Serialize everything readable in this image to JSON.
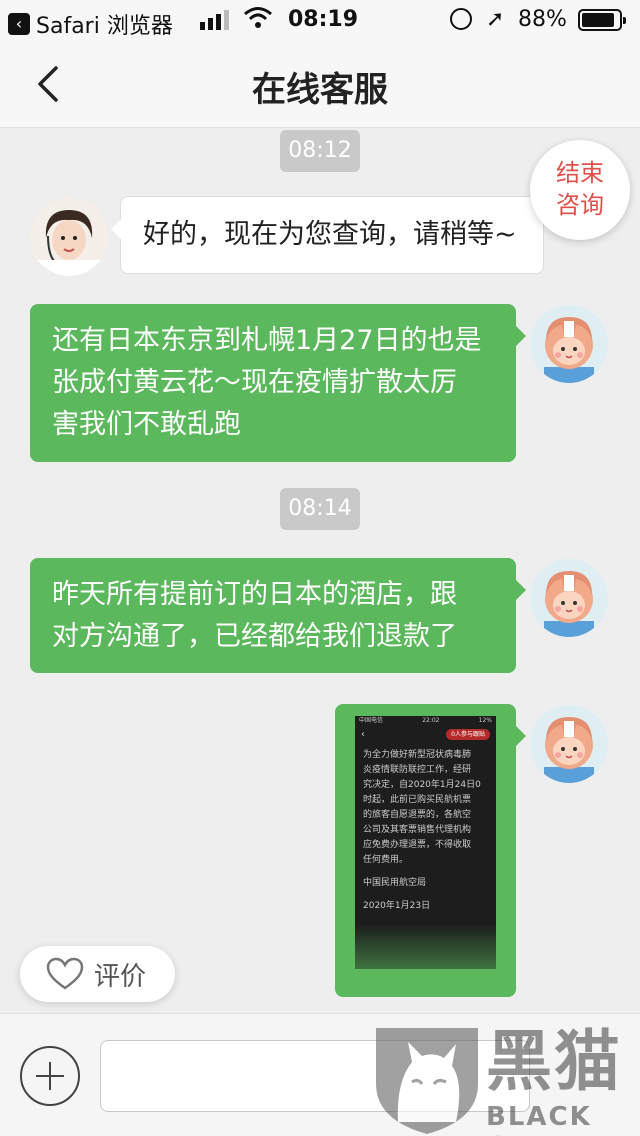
{
  "status_bar": {
    "back_app": "Safari 浏览器",
    "time": "08:19",
    "battery_pct": "88%",
    "battery_level": 0.88,
    "signal_bars": 3
  },
  "nav": {
    "title": "在线客服",
    "back_icon": "chevron-left-icon"
  },
  "end_consult": {
    "line1": "结束",
    "line2": "咨询"
  },
  "messages": [
    {
      "type": "timestamp",
      "text": "08:12"
    },
    {
      "type": "incoming",
      "text": "好的，现在为您查询，请稍等~"
    },
    {
      "type": "outgoing",
      "lines": [
        "还有日本东京到札幌1月27日的也是",
        "张成付黄云花～现在疫情扩散太厉",
        "害我们不敢乱跑"
      ]
    },
    {
      "type": "timestamp",
      "text": "08:14"
    },
    {
      "type": "outgoing",
      "lines": [
        "昨天所有提前订的日本的酒店，跟",
        "对方沟通了，已经都给我们退款了"
      ]
    },
    {
      "type": "outgoing-image",
      "screenshot": {
        "carrier": "中国电信",
        "time": "22:02",
        "battery": "12%",
        "badge": "0人参与跟贴",
        "body_lines": [
          "为全力做好新型冠状病毒肺",
          "炎疫情联防联控工作，经研",
          "究决定，自2020年1月24日0",
          "时起，此前已购买民航机票",
          "的旅客自愿退票的，各航空",
          "公司及其客票销售代理机构",
          "应免费办理退票，不得收取",
          "任何费用。"
        ],
        "org": "中国民用航空局",
        "date": "2020年1月23日"
      }
    }
  ],
  "rate_button": {
    "label": "评价",
    "icon": "heart-icon"
  },
  "composer": {
    "plus_icon": "plus-icon",
    "placeholder": ""
  },
  "watermark": {
    "cn": "黑猫",
    "en": "BLACK CAT"
  },
  "colors": {
    "accent_green": "#5cb85c",
    "end_red": "#e0504a",
    "timestamp_bg": "#c9c9c9"
  }
}
